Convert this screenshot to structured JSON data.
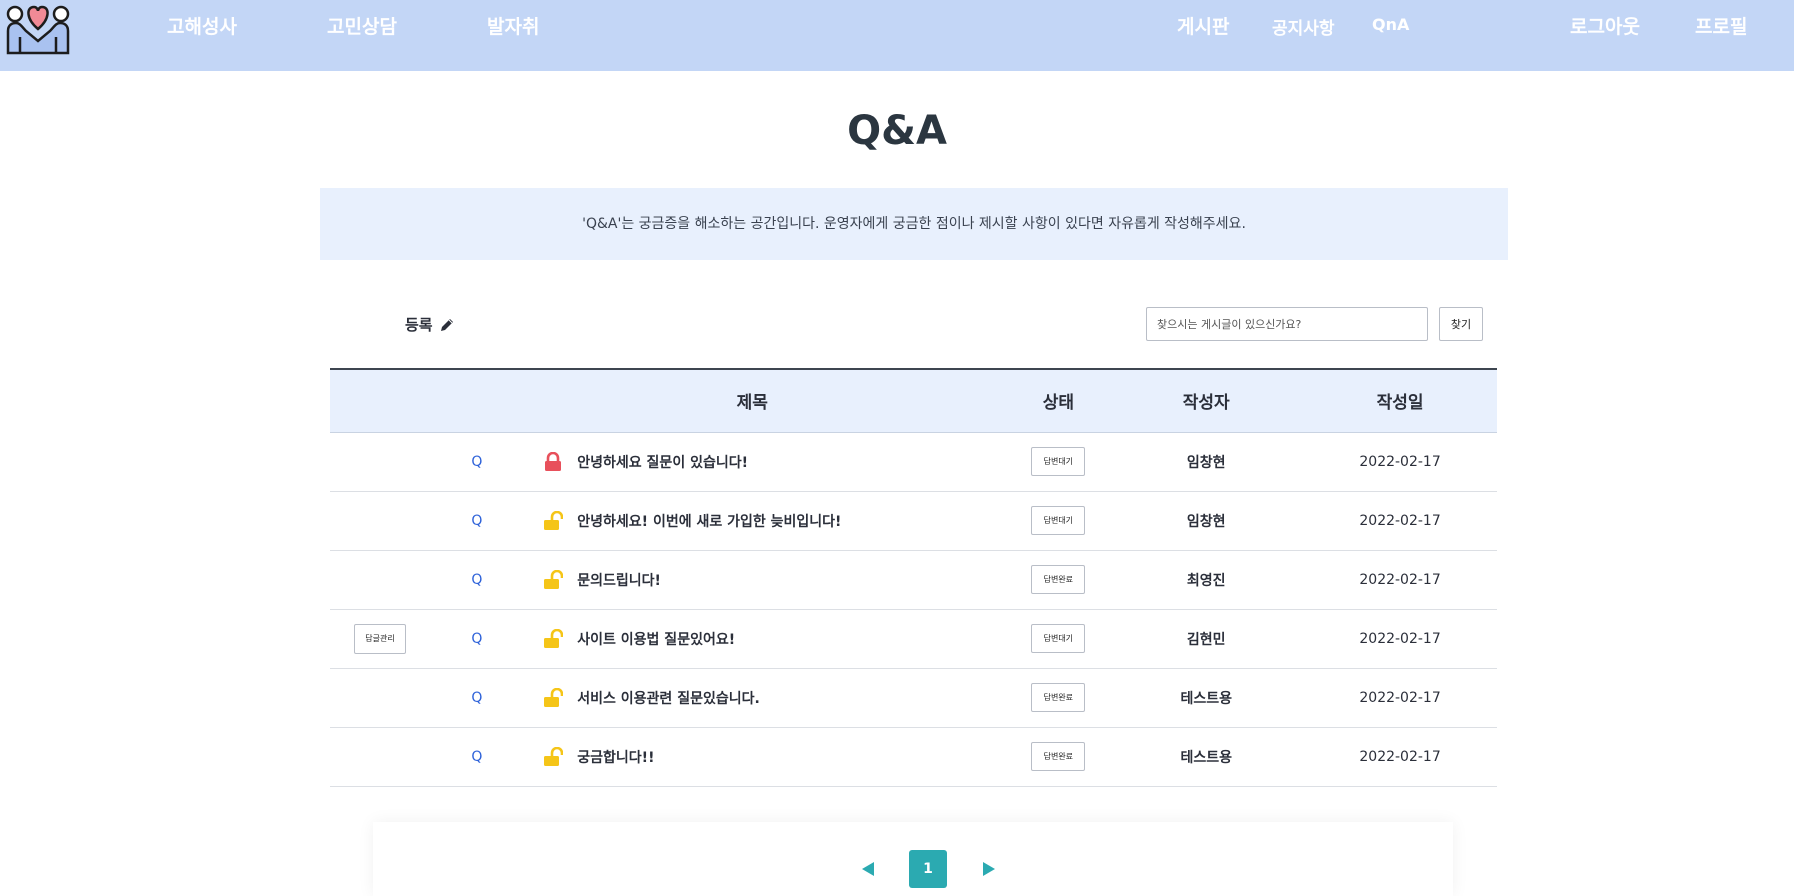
{
  "nav": {
    "left_links": [
      "고해성사",
      "고민상담",
      "발자취"
    ],
    "right_links": [
      "게시판",
      "공지사항",
      "QnA"
    ],
    "logout": "로그아웃",
    "profile": "프로필",
    "bar_color": "#c3d6f6"
  },
  "page": {
    "title": "Q&A",
    "description": "'Q&A'는 궁금증을 해소하는 공간입니다. 운영자에게 궁금한 점이나 제시할 사항이 있다면 자유롭게 작성해주세요."
  },
  "toolbar": {
    "register_label": "등록",
    "search_placeholder": "찾으시는 게시글이 있으신가요?",
    "search_button": "찾기"
  },
  "table": {
    "headers": {
      "title": "제목",
      "status": "상태",
      "writer": "작성자",
      "date": "작성일"
    },
    "rows": [
      {
        "admin": "",
        "q": "Q",
        "locked": true,
        "title": "안녕하세요 질문이 있습니다!",
        "status": "답변대기",
        "writer": "임창현",
        "date": "2022-02-17"
      },
      {
        "admin": "",
        "q": "Q",
        "locked": false,
        "title": "안녕하세요! 이번에 새로 가입한 늦비입니다!",
        "status": "답변대기",
        "writer": "임창현",
        "date": "2022-02-17"
      },
      {
        "admin": "",
        "q": "Q",
        "locked": false,
        "title": "문의드립니다!",
        "status": "답변완료",
        "writer": "최영진",
        "date": "2022-02-17"
      },
      {
        "admin": "답글관리",
        "q": "Q",
        "locked": false,
        "title": "사이트 이용법 질문있어요!",
        "status": "답변대기",
        "writer": "김현민",
        "date": "2022-02-17"
      },
      {
        "admin": "",
        "q": "Q",
        "locked": false,
        "title": "서비스 이용관련 질문있습니다.",
        "status": "답변완료",
        "writer": "테스트용",
        "date": "2022-02-17"
      },
      {
        "admin": "",
        "q": "Q",
        "locked": false,
        "title": "궁금합니다!!",
        "status": "답변완료",
        "writer": "테스트용",
        "date": "2022-02-17"
      }
    ],
    "lock_colors": {
      "locked": "#e8505b",
      "unlocked": "#f5c518"
    }
  },
  "pagination": {
    "current": "1",
    "accent": "#2baab1"
  }
}
